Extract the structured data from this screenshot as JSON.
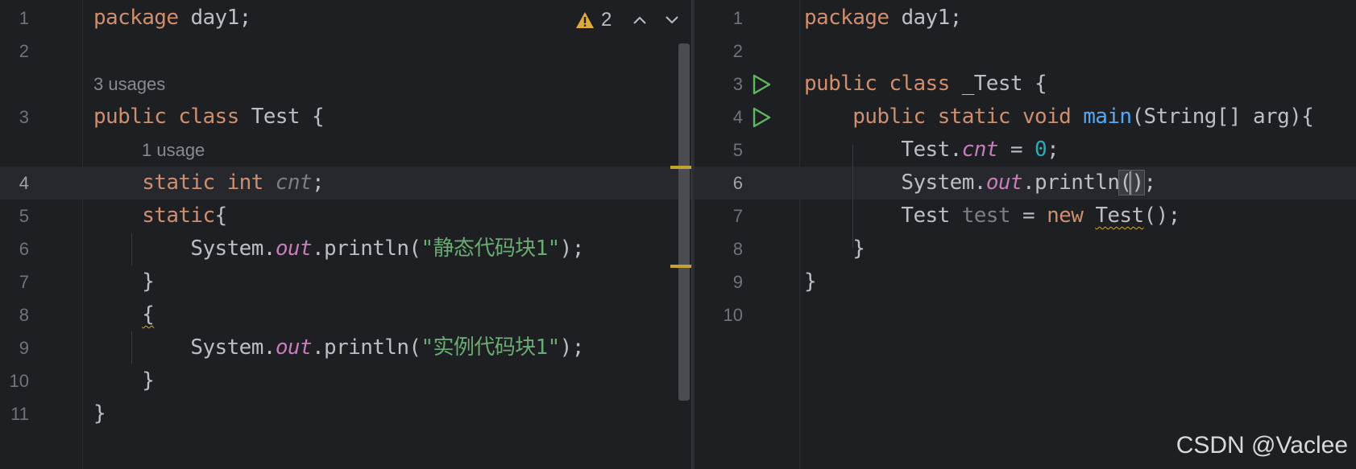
{
  "left_editor": {
    "inspection": {
      "warning_count": "2",
      "warning_icon": "warning-triangle-icon",
      "prev_icon": "chevron-up-icon",
      "next_icon": "chevron-down-icon"
    },
    "lines": [
      {
        "ln": "1",
        "segments": [
          {
            "t": "package ",
            "c": "kw"
          },
          {
            "t": "day1;",
            "c": ""
          }
        ]
      },
      {
        "ln": "2",
        "segments": []
      },
      {
        "inlay": "3 usages"
      },
      {
        "ln": "3",
        "segments": [
          {
            "t": "public ",
            "c": "kw"
          },
          {
            "t": "class ",
            "c": "kw"
          },
          {
            "t": "Test {",
            "c": ""
          }
        ]
      },
      {
        "inlay": "1 usage"
      },
      {
        "ln": "4",
        "segments": [
          {
            "t": "    static ",
            "c": "kw"
          },
          {
            "t": "int ",
            "c": "kw"
          },
          {
            "t": "cnt",
            "c": "unused"
          },
          {
            "t": ";",
            "c": ""
          }
        ]
      },
      {
        "ln": "5",
        "segments": [
          {
            "t": "    static",
            "c": "kw"
          },
          {
            "t": "{",
            "c": ""
          }
        ]
      },
      {
        "ln": "6",
        "segments": [
          {
            "t": "        System.",
            "c": ""
          },
          {
            "t": "out",
            "c": "field-i"
          },
          {
            "t": ".println(",
            "c": ""
          },
          {
            "t": "\"静态代码块1\"",
            "c": "str"
          },
          {
            "t": ");",
            "c": ""
          }
        ]
      },
      {
        "ln": "7",
        "segments": [
          {
            "t": "    }",
            "c": ""
          }
        ]
      },
      {
        "ln": "8",
        "segments": [
          {
            "t": "    ",
            "c": ""
          },
          {
            "t": "{",
            "c": "squiggle"
          }
        ]
      },
      {
        "ln": "9",
        "segments": [
          {
            "t": "        System.",
            "c": ""
          },
          {
            "t": "out",
            "c": "field-i"
          },
          {
            "t": ".println(",
            "c": ""
          },
          {
            "t": "\"实例代码块1\"",
            "c": "str"
          },
          {
            "t": ");",
            "c": ""
          }
        ]
      },
      {
        "ln": "10",
        "segments": [
          {
            "t": "    }",
            "c": ""
          }
        ]
      },
      {
        "ln": "11",
        "segments": [
          {
            "t": "}",
            "c": ""
          }
        ]
      }
    ]
  },
  "right_editor": {
    "lines": [
      {
        "ln": "1",
        "segments": [
          {
            "t": "package ",
            "c": "kw"
          },
          {
            "t": "day1;",
            "c": ""
          }
        ]
      },
      {
        "ln": "2",
        "segments": []
      },
      {
        "ln": "3",
        "run": true,
        "segments": [
          {
            "t": "public ",
            "c": "kw"
          },
          {
            "t": "class ",
            "c": "kw"
          },
          {
            "t": "_Test {",
            "c": ""
          }
        ]
      },
      {
        "ln": "4",
        "run": true,
        "segments": [
          {
            "t": "    public ",
            "c": "kw"
          },
          {
            "t": "static ",
            "c": "kw"
          },
          {
            "t": "void ",
            "c": "kw"
          },
          {
            "t": "main",
            "c": "fn"
          },
          {
            "t": "(String[] arg){",
            "c": ""
          }
        ]
      },
      {
        "ln": "5",
        "segments": [
          {
            "t": "        Test.",
            "c": ""
          },
          {
            "t": "cnt",
            "c": "field-i"
          },
          {
            "t": " = ",
            "c": ""
          },
          {
            "t": "0",
            "c": "num"
          },
          {
            "t": ";",
            "c": ""
          }
        ]
      },
      {
        "ln": "6",
        "caret": true,
        "segments": [
          {
            "t": "        System.",
            "c": ""
          },
          {
            "t": "out",
            "c": "field-i"
          },
          {
            "t": ".println",
            "c": ""
          },
          {
            "t": "(",
            "c": "caret-box"
          },
          {
            "t": ")",
            "c": "caret-after"
          },
          {
            "t": ";",
            "c": ""
          }
        ]
      },
      {
        "ln": "7",
        "segments": [
          {
            "t": "        Test ",
            "c": ""
          },
          {
            "t": "test",
            "c": "unused-var"
          },
          {
            "t": " = ",
            "c": ""
          },
          {
            "t": "new ",
            "c": "kw"
          },
          {
            "t": "Test",
            "c": "squiggle"
          },
          {
            "t": "();",
            "c": ""
          }
        ]
      },
      {
        "ln": "8",
        "segments": [
          {
            "t": "    }",
            "c": ""
          }
        ]
      },
      {
        "ln": "9",
        "segments": [
          {
            "t": "}",
            "c": ""
          }
        ]
      },
      {
        "ln": "10",
        "segments": []
      }
    ],
    "run_icon": "run-play-icon"
  },
  "watermark": "CSDN @Vaclee",
  "colors": {
    "background": "#1e1f22",
    "keyword": "#cf8e6d",
    "string": "#6aab73",
    "field": "#c77dbb",
    "number": "#2aacb8",
    "function": "#56a8f5",
    "warning": "#d6a82d",
    "run": "#5fb85f",
    "accent": "#3574f0"
  }
}
